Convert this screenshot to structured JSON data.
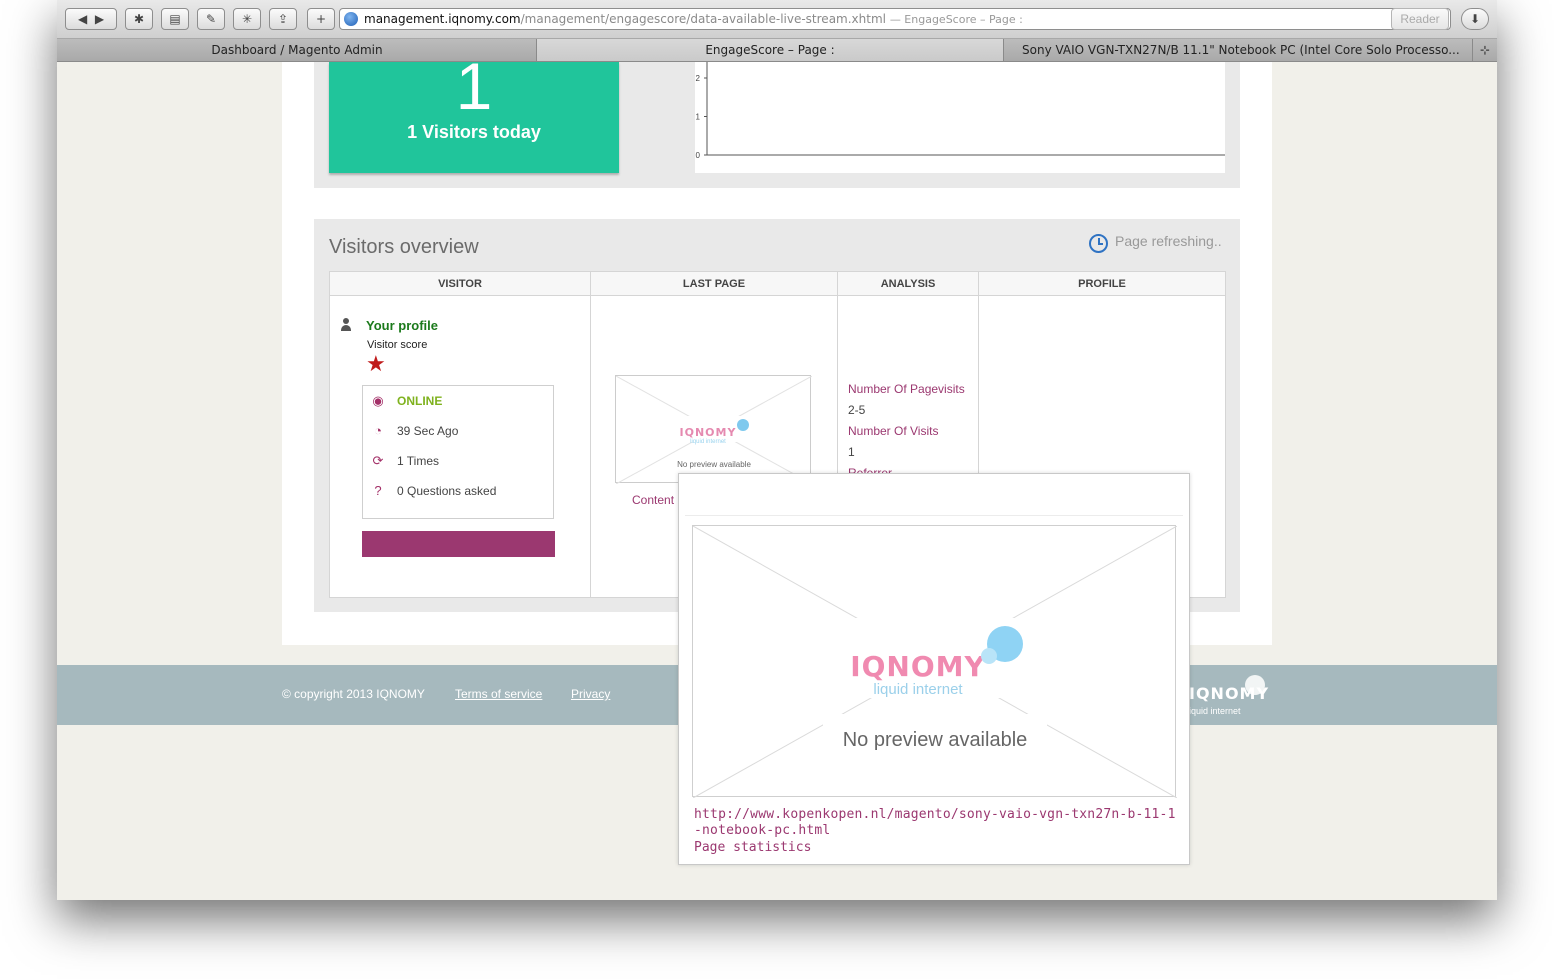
{
  "browser": {
    "address": {
      "host": "management.iqnomy.com",
      "path": "/management/engagescore/data-available-live-stream.xhtml",
      "page_title": "— EngageScore – Page :"
    },
    "reader_label": "Reader",
    "tabs": [
      {
        "label": "Dashboard / Magento Admin",
        "active": false
      },
      {
        "label": "EngageScore – Page :",
        "active": true
      },
      {
        "label": "Sony VAIO VGN-TXN27N/B 11.1\" Notebook PC (Intel Core Solo Processo...",
        "active": false
      }
    ]
  },
  "visitors_tile": {
    "count": "1",
    "label": "1 Visitors today"
  },
  "chart_data": {
    "type": "line",
    "y_ticks": [
      "2",
      "1",
      "0"
    ],
    "ylim": [
      0,
      2
    ],
    "x": [],
    "values": []
  },
  "overview": {
    "title": "Visitors overview",
    "refresh_text": "Page refreshing..",
    "columns": [
      "VISITOR",
      "LAST PAGE",
      "ANALYSIS",
      "PROFILE"
    ],
    "visitor": {
      "name": "Your profile",
      "score_label": "Visitor score",
      "status": "ONLINE",
      "last_seen": "39 Sec Ago",
      "times": "1 Times",
      "questions": "0 Questions asked"
    },
    "last_page": {
      "thumb_text": "No preview available",
      "content_link": "Content"
    },
    "analysis": [
      {
        "key": "Number Of Pagevisits",
        "value": "2-5"
      },
      {
        "key": "Number Of Visits",
        "value": "1"
      },
      {
        "key": "Referrer",
        "value": ""
      }
    ]
  },
  "footer": {
    "copyright": "© copyright 2013 IQNOMY",
    "terms": "Terms of service",
    "privacy": "Privacy"
  },
  "popup": {
    "logo_main": "IQNOMY",
    "logo_sub": "liquid internet",
    "preview_text": "No preview available",
    "url": "http://www.kopenkopen.nl/magento/sony-vaio-vgn-txn27n-b-11-1-notebook-pc.html",
    "stats_link": "Page statistics"
  },
  "colors": {
    "tile": "#20c59b",
    "accent": "#9b3870",
    "online": "#7fb21e",
    "profile_name": "#1b7a1b",
    "footer": "#a6b9be"
  }
}
